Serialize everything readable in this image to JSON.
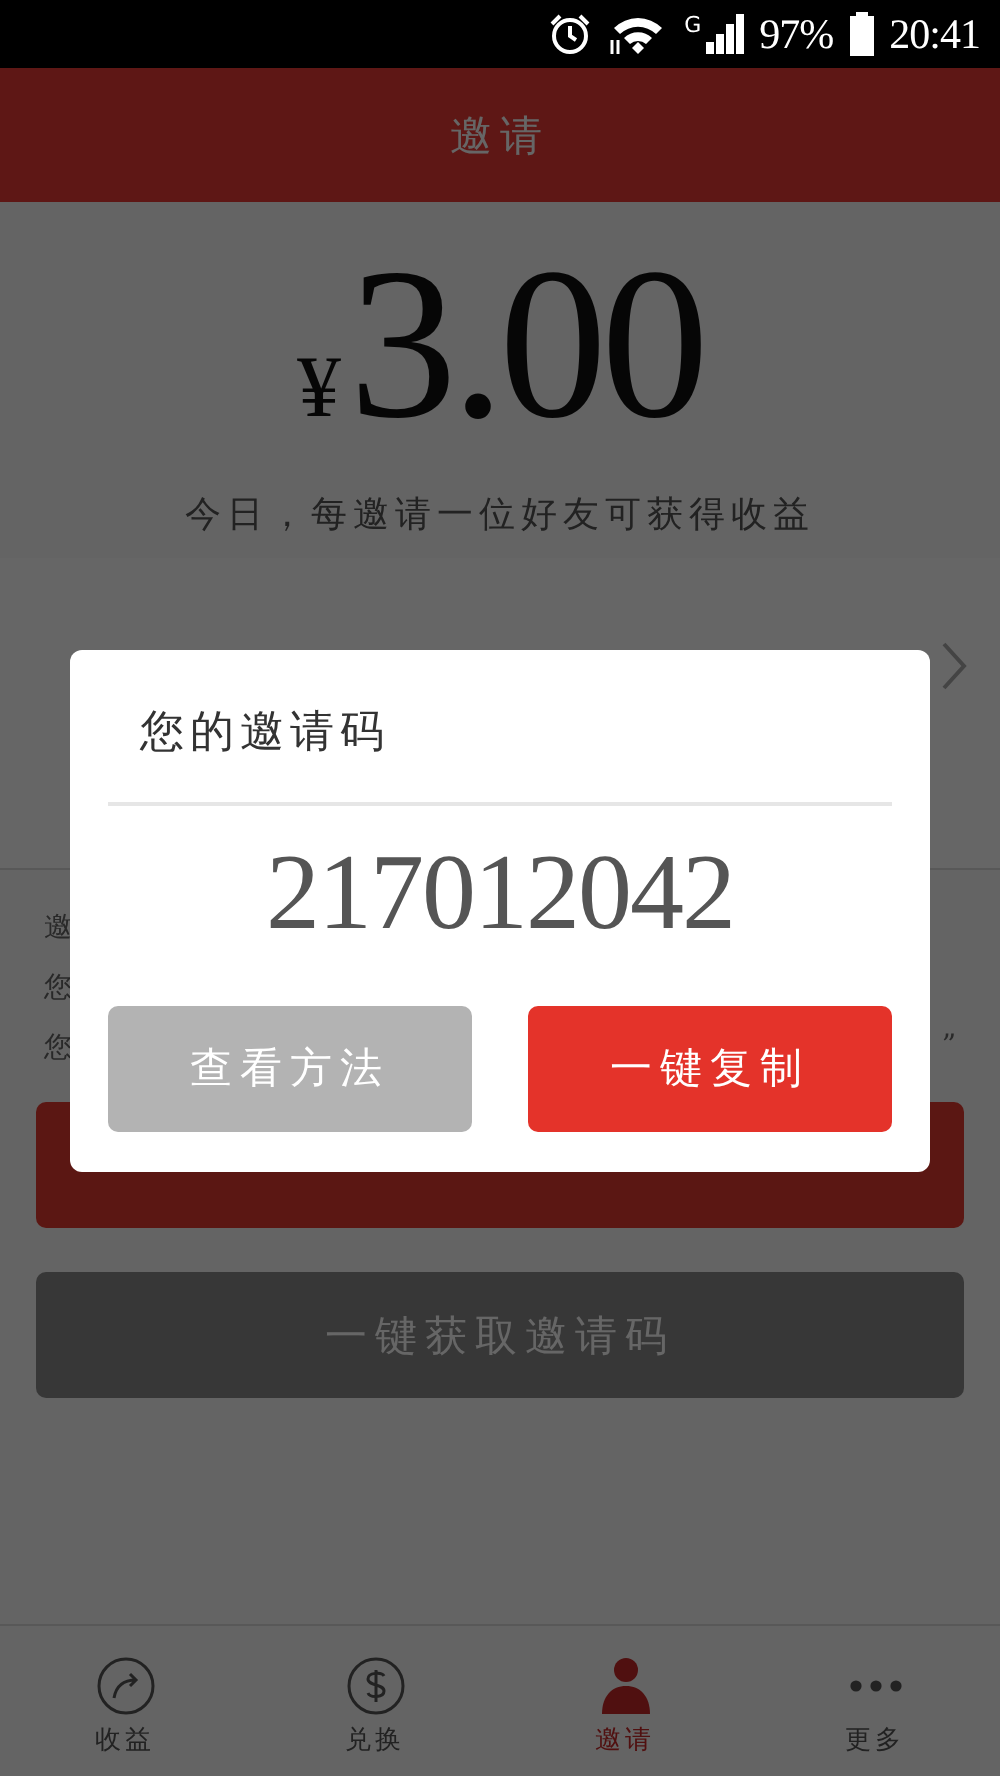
{
  "status_bar": {
    "network": "G",
    "battery": "97%",
    "time": "20:41"
  },
  "header": {
    "title": "邀请"
  },
  "reward": {
    "currency": "¥",
    "amount": "3.00",
    "caption": "今日，每邀请一位好友可获得收益"
  },
  "info_lines": [
    {
      "start": "邀"
    },
    {
      "start": "您"
    },
    {
      "start": "您",
      "end": "”"
    }
  ],
  "buttons": [
    {
      "kind": "primary"
    },
    {
      "label": "一键获取邀请码",
      "kind": "secondary"
    }
  ],
  "dialog": {
    "title": "您的邀请码",
    "code": "217012042",
    "buttons": [
      {
        "label": "查看方法",
        "kind": "secondary"
      },
      {
        "label": "一键复制",
        "kind": "primary"
      }
    ]
  },
  "tabs": [
    {
      "label": "收益",
      "kind": "trend",
      "selected": false
    },
    {
      "label": "兑换",
      "kind": "dollar",
      "selected": false
    },
    {
      "label": "邀请",
      "kind": "person",
      "selected": true
    },
    {
      "label": "更多",
      "kind": "more",
      "selected": false
    }
  ]
}
